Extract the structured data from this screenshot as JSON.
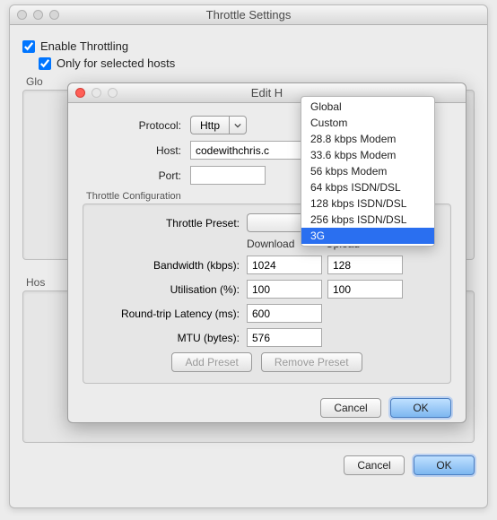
{
  "window": {
    "title": "Throttle Settings",
    "enable_label": "Enable Throttling",
    "only_hosts_label": "Only for selected hosts",
    "global_label": "Glo",
    "hosts_label": "Hos",
    "cancel": "Cancel",
    "ok": "OK"
  },
  "modal": {
    "title": "Edit H",
    "protocol_label": "Protocol:",
    "protocol_value": "Http",
    "host_label": "Host:",
    "host_value": "codewithchris.c",
    "port_label": "Port:",
    "port_value": "",
    "config_label": "Throttle Configuration",
    "preset_label": "Throttle Preset:",
    "download_head": "Download",
    "upload_head": "Upload",
    "bandwidth_label": "Bandwidth (kbps):",
    "bandwidth_down": "1024",
    "bandwidth_up": "128",
    "util_label": "Utilisation (%):",
    "util_down": "100",
    "util_up": "100",
    "latency_label": "Round-trip Latency (ms):",
    "latency_value": "600",
    "mtu_label": "MTU (bytes):",
    "mtu_value": "576",
    "add_preset": "Add Preset",
    "remove_preset": "Remove Preset",
    "cancel": "Cancel",
    "ok": "OK"
  },
  "dropdown": {
    "items": [
      "Global",
      "Custom",
      "28.8 kbps Modem",
      "33.6 kbps Modem",
      "56 kbps Modem",
      "64 kbps ISDN/DSL",
      "128 kbps ISDN/DSL",
      "256 kbps ISDN/DSL",
      "3G"
    ],
    "selected_index": 8
  }
}
